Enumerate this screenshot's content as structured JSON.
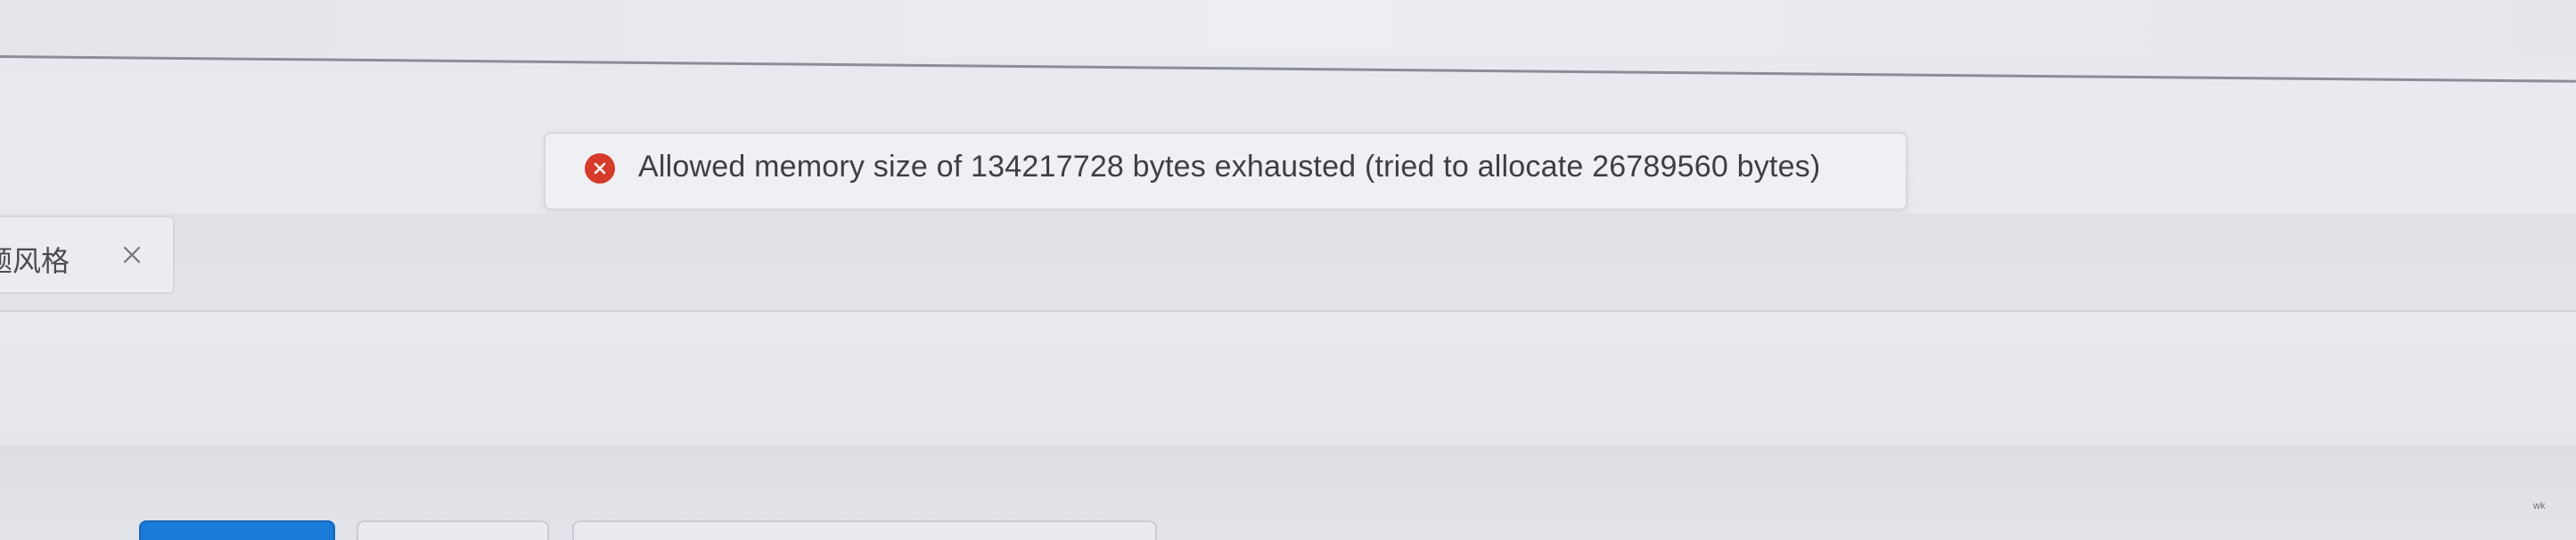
{
  "toast": {
    "type": "error",
    "icon": "error-circle-icon",
    "message": "Allowed memory size of 134217728 bytes exhausted (tried to allocate 26789560 bytes)",
    "icon_color": "#d63a2a"
  },
  "tabs": [
    {
      "label": "题风格",
      "close_icon": "close-icon"
    }
  ],
  "footer": {
    "buttons": [
      {
        "kind": "primary",
        "label": ""
      },
      {
        "kind": "secondary",
        "label": ""
      },
      {
        "kind": "secondary",
        "label": ""
      }
    ],
    "primary_color": "#1a7bd9"
  },
  "corner_mark": "wk"
}
